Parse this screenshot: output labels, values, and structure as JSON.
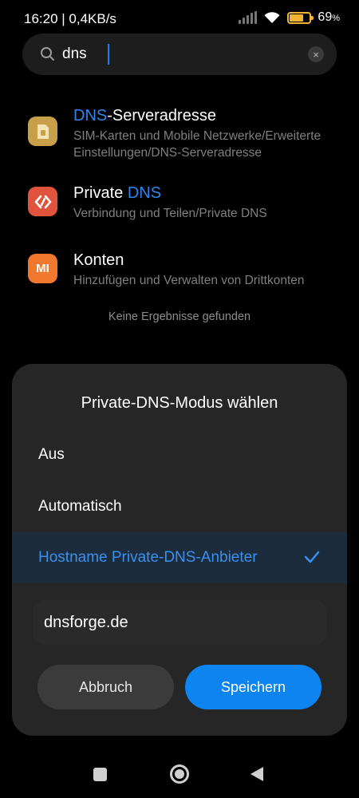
{
  "status": {
    "time_speed": "16:20 | 0,4KB/s",
    "battery_percent": "69",
    "battery_unit": "%",
    "battery_level": 0.69,
    "colors": {
      "battery": "#f2b533"
    }
  },
  "search": {
    "query": "dns",
    "clear_icon": "×"
  },
  "results": [
    {
      "title_highlight": "DNS",
      "title_rest": "-Serveradresse",
      "subtitle": "SIM-Karten und Mobile Netzwerke/Erweiterte Einstellungen/DNS-Serveradresse",
      "icon": "sim-card-icon",
      "icon_color": "#c9a04a"
    },
    {
      "title_rest": "Private ",
      "title_highlight": "DNS",
      "subtitle": "Verbindung und Teilen/Private DNS",
      "icon": "connection-icon",
      "icon_color": "#e0543e"
    },
    {
      "title": "Konten",
      "subtitle": "Hinzufügen und Verwalten von Drittkonten",
      "icon": "mi-logo-icon",
      "icon_color": "#f27830",
      "icon_glyph": "MI"
    }
  ],
  "no_results": "Keine Ergebnisse gefunden",
  "dialog": {
    "title": "Private-DNS-Modus wählen",
    "options": [
      {
        "label": "Aus",
        "selected": false
      },
      {
        "label": "Automatisch",
        "selected": false
      },
      {
        "label": "Hostname Private-DNS-Anbieter",
        "selected": true
      }
    ],
    "hostname": "dnsforge.de",
    "cancel_label": "Abbruch",
    "save_label": "Speichern",
    "colors": {
      "accent": "#3a90ef",
      "save_button": "#0d84f0"
    }
  },
  "nav": {
    "recents": "square-icon",
    "home": "home-circle-icon",
    "back": "back-triangle-icon"
  }
}
